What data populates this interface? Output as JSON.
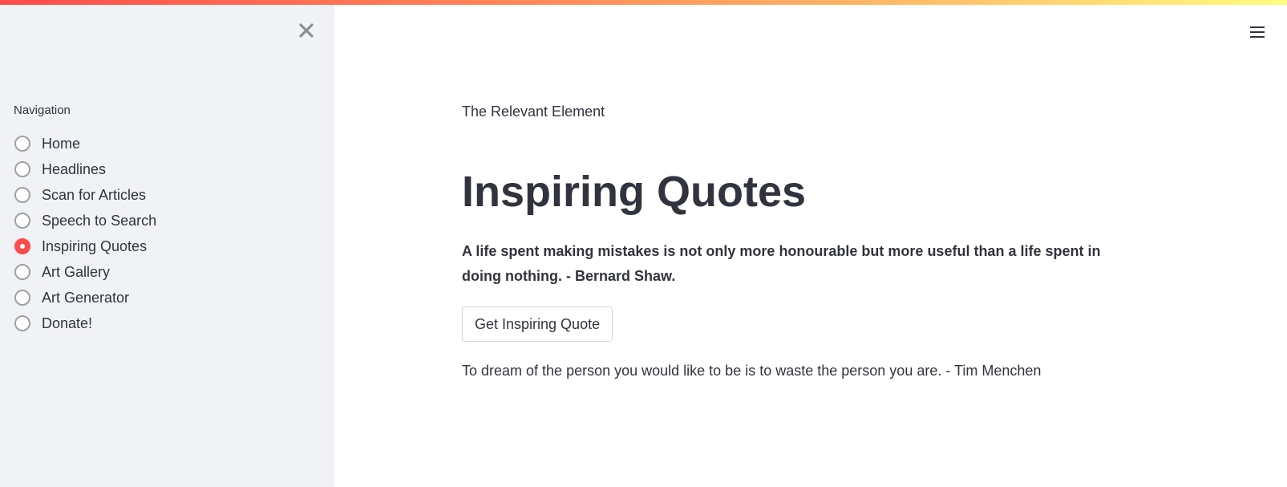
{
  "colors": {
    "accent": "#ff4b4b",
    "sidebar_bg": "#f0f2f6",
    "text": "#31333f"
  },
  "sidebar": {
    "close_icon": "close-icon",
    "nav_label": "Navigation",
    "selected": "Inspiring Quotes",
    "items": [
      {
        "label": "Home",
        "checked": false
      },
      {
        "label": "Headlines",
        "checked": false
      },
      {
        "label": "Scan for Articles",
        "checked": false
      },
      {
        "label": "Speech to Search",
        "checked": false
      },
      {
        "label": "Inspiring Quotes",
        "checked": true
      },
      {
        "label": "Art Gallery",
        "checked": false
      },
      {
        "label": "Art Generator",
        "checked": false
      },
      {
        "label": "Donate!",
        "checked": false
      }
    ]
  },
  "header": {
    "menu_icon": "hamburger-menu-icon"
  },
  "main": {
    "brand": "The Relevant Element",
    "title": "Inspiring Quotes",
    "featured_quote": "A life spent making mistakes is not only more honourable but more useful than a life spent in doing nothing. - Bernard Shaw.",
    "button_label": "Get Inspiring Quote",
    "result_quote": "To dream of the person you would like to be is to waste the person you are. - Tim Menchen"
  }
}
